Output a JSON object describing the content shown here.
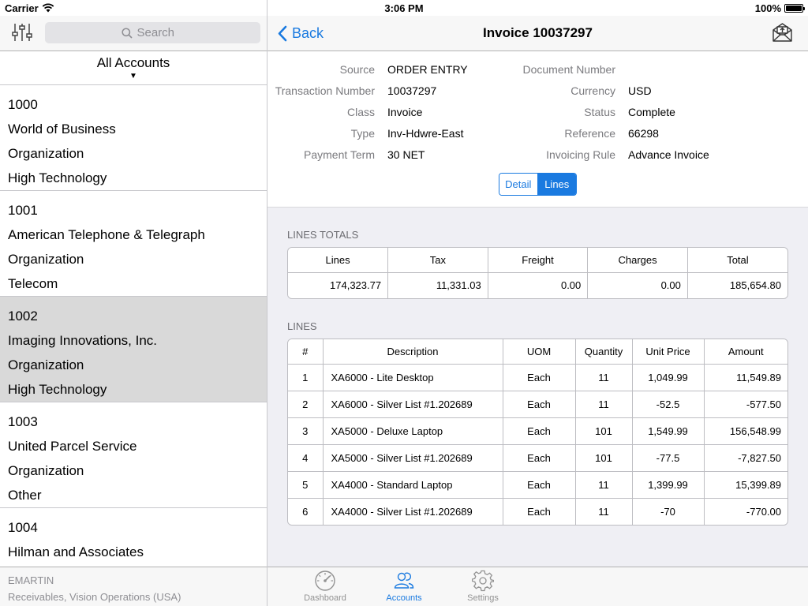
{
  "status_bar": {
    "carrier": "Carrier",
    "time": "3:06 PM",
    "battery": "100%"
  },
  "left": {
    "search": {
      "placeholder": "Search"
    },
    "header": {
      "title": "All Accounts",
      "caret": "▼"
    },
    "accounts": [
      {
        "number": "1000",
        "name": "World of Business",
        "type": "Organization",
        "industry": "High Technology"
      },
      {
        "number": "1001",
        "name": "American Telephone & Telegraph",
        "type": "Organization",
        "industry": "Telecom"
      },
      {
        "number": "1002",
        "name": "Imaging Innovations, Inc.",
        "type": "Organization",
        "industry": "High Technology"
      },
      {
        "number": "1003",
        "name": "United Parcel Service",
        "type": "Organization",
        "industry": "Other"
      },
      {
        "number": "1004",
        "name": "Hilman and Associates",
        "type": "",
        "industry": ""
      }
    ],
    "footer": {
      "user": "EMARTIN",
      "org": "Receivables, Vision Operations (USA)"
    }
  },
  "nav": {
    "back_label": "Back",
    "title": "Invoice 10037297"
  },
  "detail": {
    "source_label": "Source",
    "source_value": "ORDER ENTRY",
    "docnum_label": "Document Number",
    "docnum_value": "",
    "txn_label": "Transaction Number",
    "txn_value": "10037297",
    "currency_label": "Currency",
    "currency_value": "USD",
    "class_label": "Class",
    "class_value": "Invoice",
    "status_label": "Status",
    "status_value": "Complete",
    "type_label": "Type",
    "type_value": "Inv-Hdwre-East",
    "reference_label": "Reference",
    "reference_value": "66298",
    "term_label": "Payment Term",
    "term_value": "30 NET",
    "rule_label": "Invoicing Rule",
    "rule_value": "Advance Invoice"
  },
  "segment": {
    "detail": "Detail",
    "lines": "Lines",
    "selected": "Lines"
  },
  "totals": {
    "title": "LINES TOTALS",
    "headers": [
      "Lines",
      "Tax",
      "Freight",
      "Charges",
      "Total"
    ],
    "values": [
      "174,323.77",
      "11,331.03",
      "0.00",
      "0.00",
      "185,654.80"
    ]
  },
  "lines": {
    "title": "LINES",
    "headers": [
      "#",
      "Description",
      "UOM",
      "Quantity",
      "Unit Price",
      "Amount"
    ],
    "rows": [
      [
        "1",
        "XA6000 - Lite Desktop",
        "Each",
        "11",
        "1,049.99",
        "11,549.89"
      ],
      [
        "2",
        "XA6000 - Silver List #1.202689",
        "Each",
        "11",
        "-52.5",
        "-577.50"
      ],
      [
        "3",
        "XA5000 - Deluxe Laptop",
        "Each",
        "101",
        "1,549.99",
        "156,548.99"
      ],
      [
        "4",
        "XA5000 - Silver List #1.202689",
        "Each",
        "101",
        "-77.5",
        "-7,827.50"
      ],
      [
        "5",
        "XA4000 - Standard Laptop",
        "Each",
        "11",
        "1,399.99",
        "15,399.89"
      ],
      [
        "6",
        "XA4000 - Silver List #1.202689",
        "Each",
        "11",
        "-70",
        "-770.00"
      ]
    ]
  },
  "tabs": [
    {
      "label": "Dashboard",
      "icon": "dashboard-gauge-icon"
    },
    {
      "label": "Accounts",
      "icon": "accounts-people-icon",
      "active": true
    },
    {
      "label": "Settings",
      "icon": "settings-gear-icon"
    }
  ],
  "colors": {
    "accent": "#1a7ae0",
    "selected_row": "#d9d9d9",
    "content_bg": "#efeff4"
  }
}
